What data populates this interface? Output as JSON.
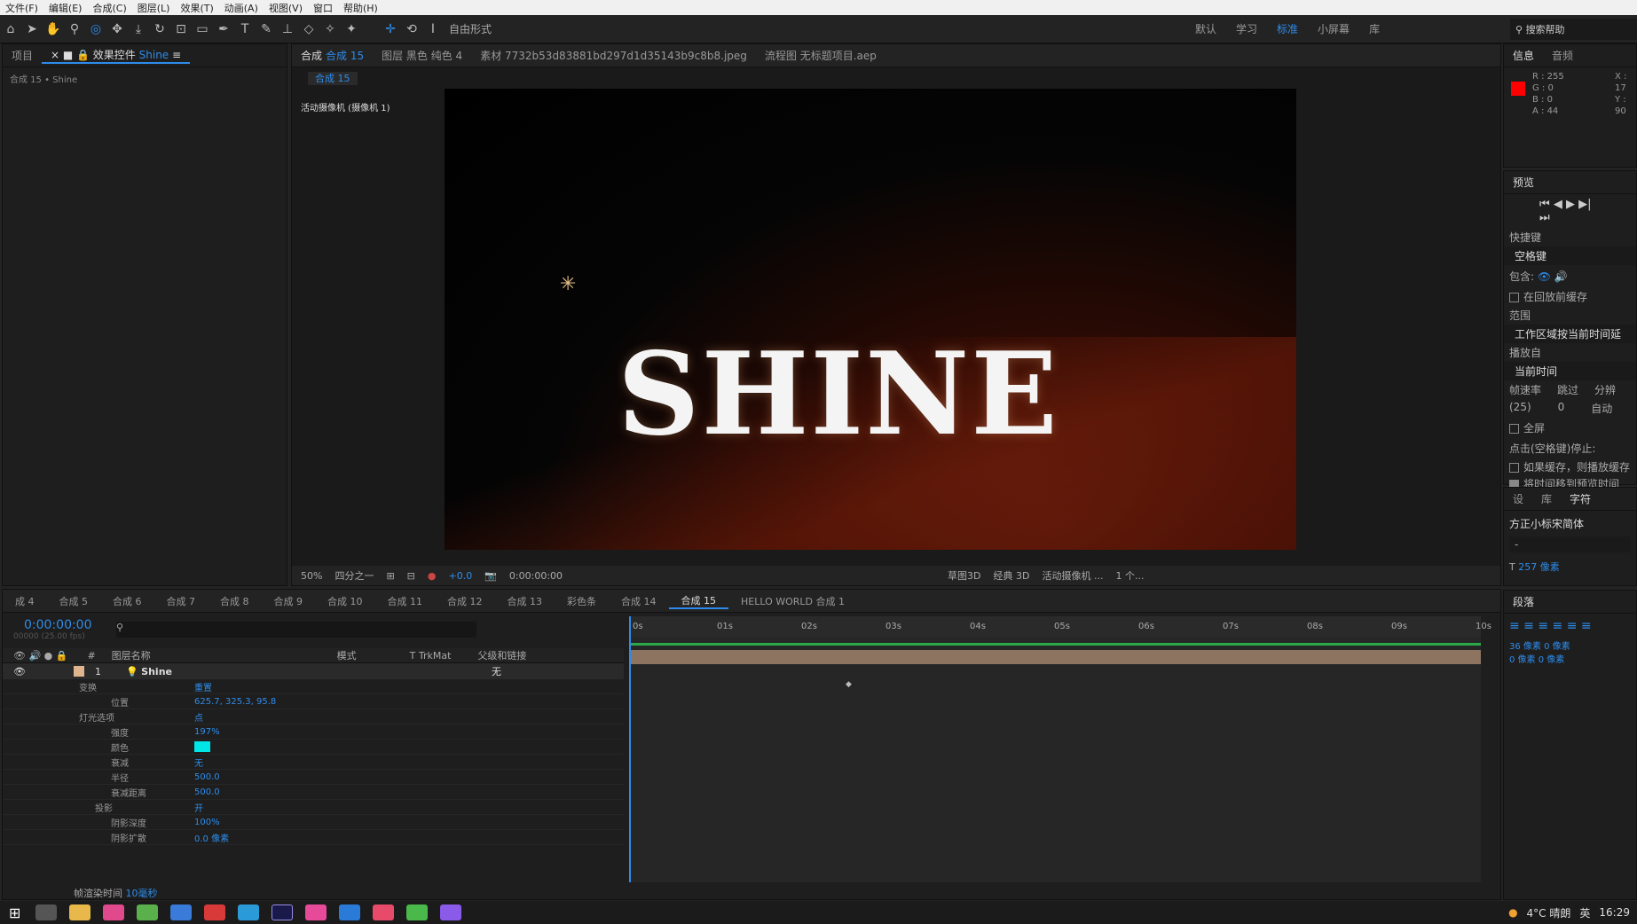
{
  "menu": [
    "文件(F)",
    "编辑(E)",
    "合成(C)",
    "图层(L)",
    "效果(T)",
    "动画(A)",
    "视图(V)",
    "窗口",
    "帮助(H)"
  ],
  "toolbar": {
    "mode": "自由形式",
    "workspaces": [
      "默认",
      "学习",
      "标准",
      "小屏幕",
      "库"
    ],
    "search": "搜索帮助"
  },
  "project": {
    "tab1": "项目",
    "tab2": "效果控件",
    "tab2_target": "Shine",
    "breadcrumb": "合成 15 • Shine"
  },
  "viewer": {
    "tabs": [
      "合成",
      "合成 15",
      "图层 黑色 纯色 4",
      "素材 7732b53d83881bd297d1d35143b9c8b8.jpeg",
      "流程图 无标题项目.aep"
    ],
    "subtab": "合成 15",
    "camera_label": "活动摄像机 (摄像机 1)",
    "title_text": "SHINE",
    "zoom": "50%",
    "res": "四分之一",
    "exposure": "+0.0",
    "timecode": "0:00:00:00",
    "draft3d": "草图3D",
    "renderer": "经典 3D",
    "camera_sel": "活动摄像机 ...",
    "views": "1 个..."
  },
  "info": {
    "tab1": "信息",
    "tab2": "音频",
    "r": "R : 255",
    "g": "G : 0",
    "b": "B : 0",
    "a": "A : 44",
    "x": "X : 17",
    "y": "Y : 90",
    "swatch": "#ff0000"
  },
  "preview": {
    "title": "预览",
    "shortcut_label": "快捷键",
    "shortcut": "空格键",
    "include": "包含:",
    "cache": "在回放前缓存",
    "range_label": "范围",
    "range": "工作区域按当前时间延",
    "playfrom_label": "播放自",
    "playfrom": "当前时间",
    "fps_label": "帧速率",
    "skip_label": "跳过",
    "split_label": "分辨",
    "fps": "(25)",
    "skip": "0",
    "auto": "自动",
    "fullscreen": "全屏",
    "click_stop": "点击(空格键)停止:",
    "if_cache": "如果缓存，则播放缓存",
    "move_time": "将时间移到预览时间"
  },
  "char": {
    "tabs": [
      "设",
      "库",
      "字符"
    ],
    "font": "方正小标宋简体",
    "style": "-",
    "size": "257 像素",
    "para": "段落",
    "indent1": "36 像素",
    "indent2": "0 像素",
    "indent3": "0 像素",
    "indent4": "0 像素"
  },
  "timeline": {
    "tabs": [
      "成 4",
      "合成 5",
      "合成 6",
      "合成 7",
      "合成 8",
      "合成 9",
      "合成 10",
      "合成 11",
      "合成 12",
      "合成 13",
      "彩色条",
      "合成 14",
      "合成 15",
      "HELLO WORLD 合成 1"
    ],
    "time": "0:00:00:00",
    "fps": "00000 (25.00 fps)",
    "col_num": "#",
    "col_name": "图层名称",
    "col_mode": "模式",
    "col_trk": "T  TrkMat",
    "col_parent": "父级和链接",
    "layer_num": "1",
    "layer_name": "Shine",
    "parent": "无",
    "render_label": "帧渲染时间",
    "render_val": "10毫秒",
    "ruler": [
      "0s",
      "01s",
      "02s",
      "03s",
      "04s",
      "05s",
      "06s",
      "07s",
      "08s",
      "09s",
      "10s"
    ]
  },
  "props": [
    {
      "name": "变换",
      "val": "重置",
      "indent": 1
    },
    {
      "name": "位置",
      "val": "625.7, 325.3, 95.8",
      "indent": 3
    },
    {
      "name": "灯光选项",
      "val": "点",
      "indent": 1
    },
    {
      "name": "强度",
      "val": "197%",
      "indent": 3
    },
    {
      "name": "颜色",
      "val": "",
      "indent": 3
    },
    {
      "name": "衰减",
      "val": "无",
      "indent": 3
    },
    {
      "name": "半径",
      "val": "500.0",
      "indent": 3
    },
    {
      "name": "衰减距离",
      "val": "500.0",
      "indent": 3
    },
    {
      "name": "投影",
      "val": "开",
      "indent": 2
    },
    {
      "name": "阴影深度",
      "val": "100%",
      "indent": 3
    },
    {
      "name": "阴影扩散",
      "val": "0.0 像素",
      "indent": 3
    }
  ],
  "taskbar": {
    "weather": "4°C 晴朗",
    "ime": "英",
    "clock": "16:29"
  }
}
